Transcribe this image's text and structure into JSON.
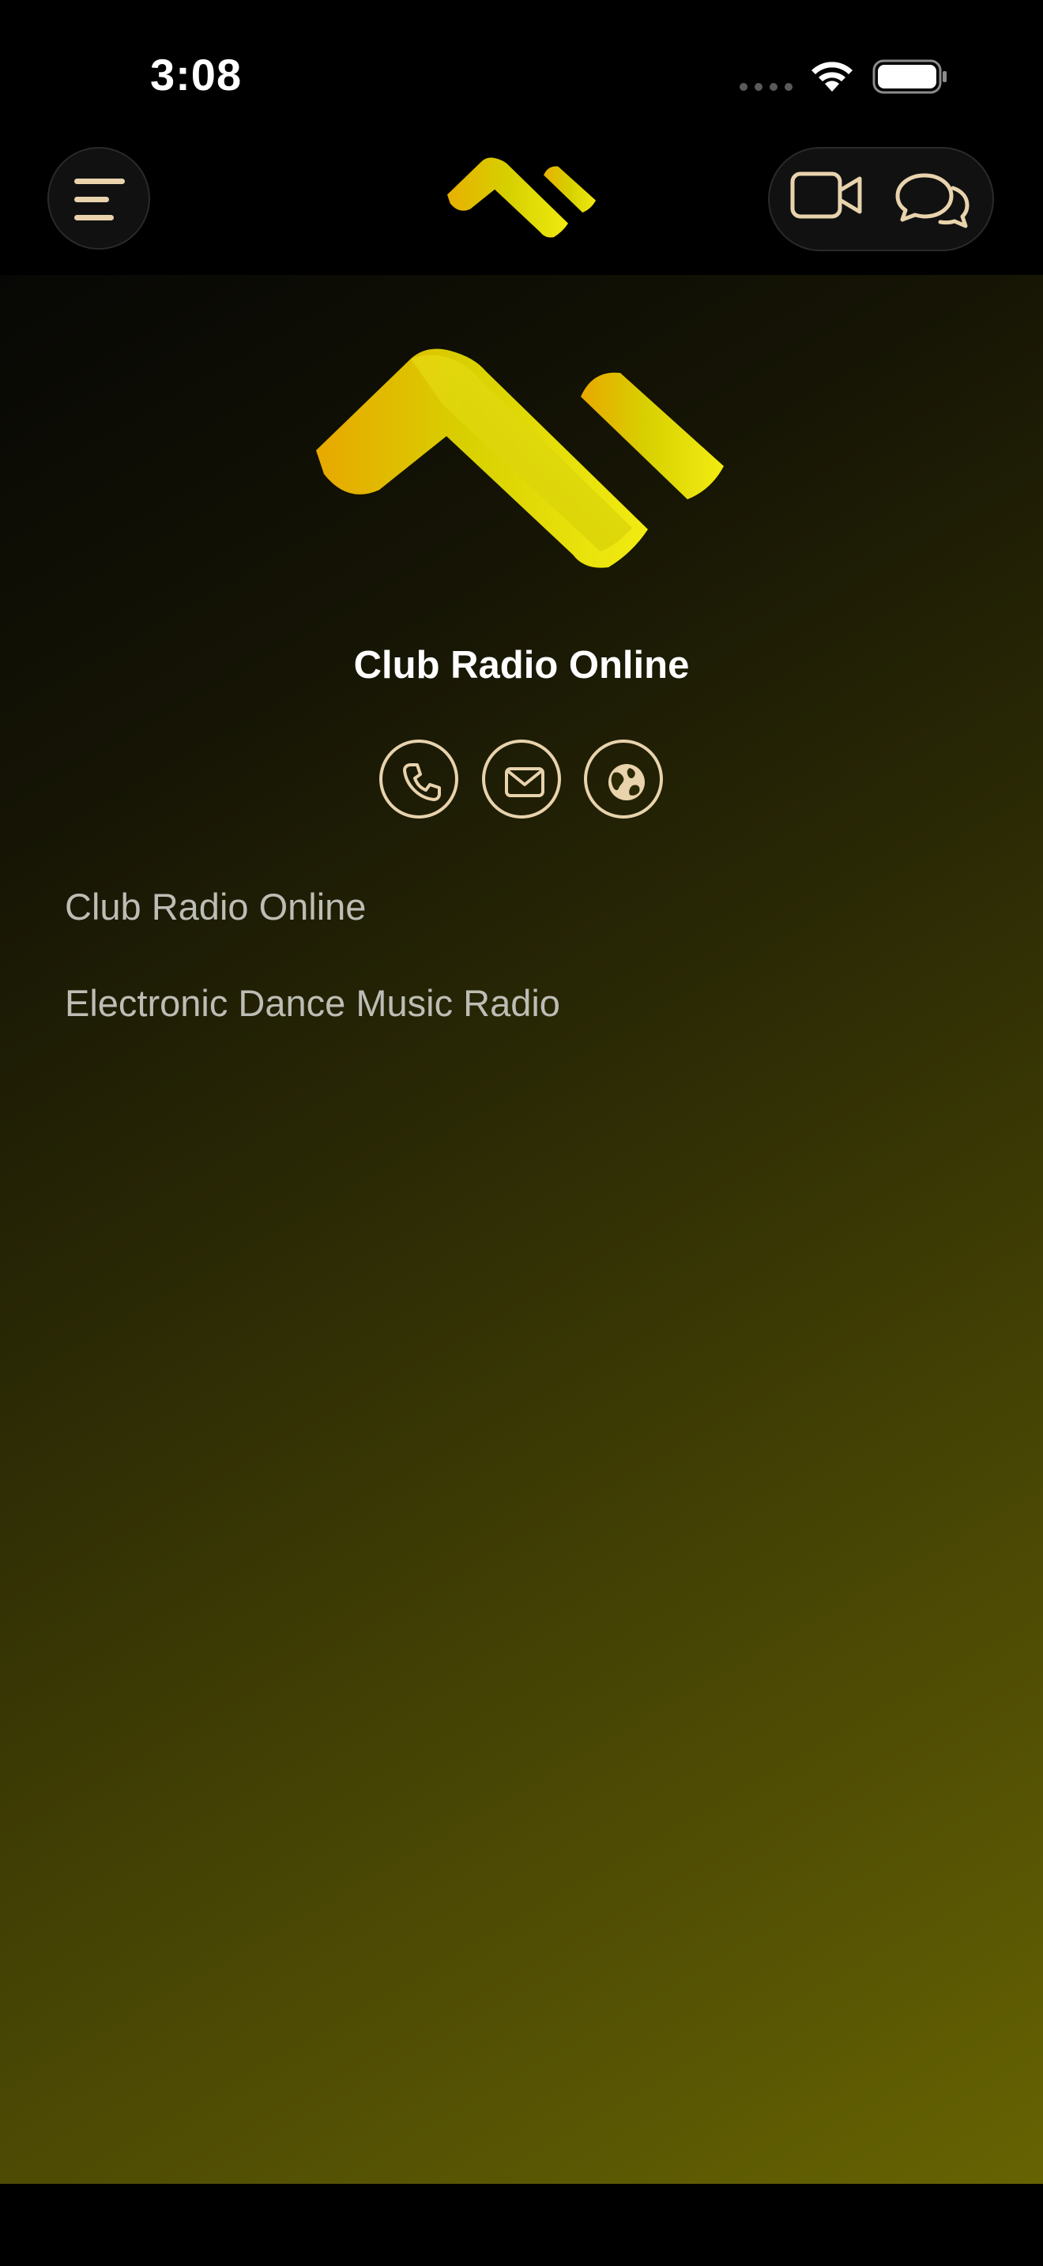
{
  "status_bar": {
    "time": "3:08"
  },
  "header": {
    "menu_icon": "menu-lines-icon",
    "logo_icon": "brand-logo-icon",
    "video_icon": "video-camera-icon",
    "chat_icon": "chat-bubbles-icon"
  },
  "station": {
    "name": "Club Radio Online",
    "contacts": [
      {
        "type": "phone",
        "icon": "phone-icon"
      },
      {
        "type": "email",
        "icon": "mail-icon"
      },
      {
        "type": "website",
        "icon": "globe-icon"
      }
    ],
    "description": {
      "line1": "Club Radio Online",
      "line2": "Electronic Dance Music Radio"
    }
  },
  "colors": {
    "accent_cream": "#e8d3ad",
    "logo_yellow": "#e6df08",
    "gradient_end": "#666303",
    "background": "#000000"
  }
}
